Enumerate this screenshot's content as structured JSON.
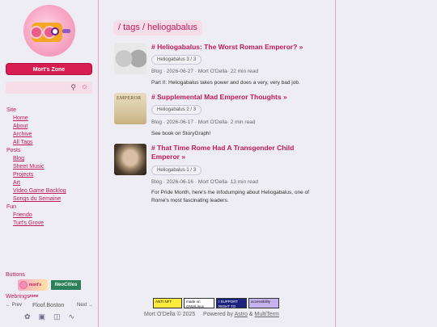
{
  "sidebar": {
    "site_button": "Mort's Zone",
    "search": {
      "placeholder": ""
    },
    "sections": [
      {
        "label": "Site",
        "items": [
          "Home",
          "About",
          "Archive",
          "All Tags"
        ]
      },
      {
        "label": "Posts",
        "items": [
          "Blog",
          "Sheet Music",
          "Projects",
          "Art",
          "Video Game Backlog",
          "Songs du Semaine"
        ]
      },
      {
        "label": "Fun",
        "items": [
          "Friendo",
          "Turt's Grove"
        ]
      }
    ],
    "buttons_label": "Buttons",
    "badge_morts": "mort's zone",
    "badge_neocities": "NeoCities",
    "webrings_label": "Webrings",
    "webring": {
      "prev": "← Prev",
      "name": "Floof.Boston",
      "next": "Next →"
    },
    "socials": [
      "butterfly-icon",
      "gamepad-icon",
      "book-icon",
      "rss-icon"
    ]
  },
  "main": {
    "breadcrumb": "/ tags  / heliogabalus",
    "posts": [
      {
        "title": "# Heliogabalus: The Worst Roman Emperor?",
        "arrow": "»",
        "series": "Heliogabalus 3 / 3",
        "meta": "Blog · 2026-06-27 · Mort O'Della· 22 min read",
        "desc": "Part II: Heliogabalus takes power and does a very, very bad job."
      },
      {
        "title": "# Supplemental Mad Emperor Thoughts",
        "arrow": "»",
        "series": "Heliogabalus 2 / 3",
        "meta": "Blog · 2026-06-17 · Mort O'Della· 2 min read",
        "desc": "See book on StoryGraph!",
        "thumb_text": "EMPEROR"
      },
      {
        "title": "# That Time Rome Had A Transgender Child Emperor",
        "arrow": "»",
        "series": "Heliogabalus 1 / 3",
        "meta": "Blog · 2026-06-16 · Mort O'Della· 13 min read",
        "desc": "For Pride Month, here's me infodumping about Heliogabalus, one of Rome's most fascinating leaders."
      }
    ]
  },
  "footer": {
    "badges": [
      "ANTI NFT",
      "made on GNU/Linux",
      "I SUPPORT RIGHT TO REPAIR",
      "accessibility"
    ],
    "copyright": "Mort O'Della © 2025",
    "powered": "Powered by",
    "astro": "Astro",
    "amp": "&",
    "multiterm": "MultiTerm"
  }
}
